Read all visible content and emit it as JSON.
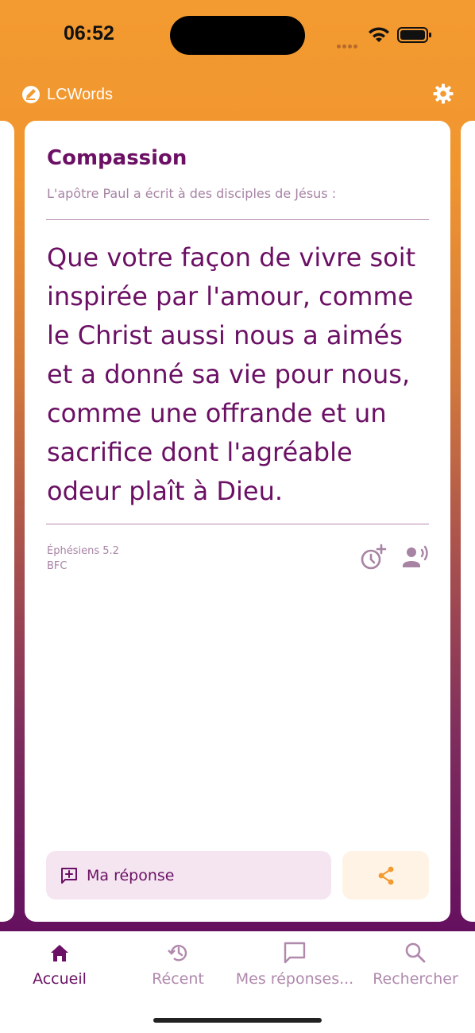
{
  "status_bar": {
    "time": "06:52"
  },
  "app": {
    "title": "LCWords"
  },
  "card": {
    "title": "Compassion",
    "intro": "L'apôtre Paul a écrit à des disciples de Jésus :",
    "verse_lines": [
      "Que votre façon de vivre soit",
      "inspirée par l'amour, comme",
      "le Christ aussi nous a aimés",
      "et a donné sa vie pour nous,",
      "comme une offrande et un",
      "sacrifice dont l'agréable",
      "odeur plaît à Dieu."
    ],
    "reference": "Éphésiens 5.2",
    "version": "BFC",
    "reply_label": "Ma réponse"
  },
  "nav": {
    "items": [
      {
        "label": "Accueil",
        "icon": "home-icon",
        "active": true
      },
      {
        "label": "Récent",
        "icon": "history-icon",
        "active": false
      },
      {
        "label": "Mes réponses...",
        "icon": "chat-icon",
        "active": false
      },
      {
        "label": "Rechercher",
        "icon": "search-icon",
        "active": false
      }
    ]
  },
  "colors": {
    "brand_purple": "#6b1064",
    "brand_orange": "#f39a30",
    "muted_purple": "#a783a4"
  }
}
